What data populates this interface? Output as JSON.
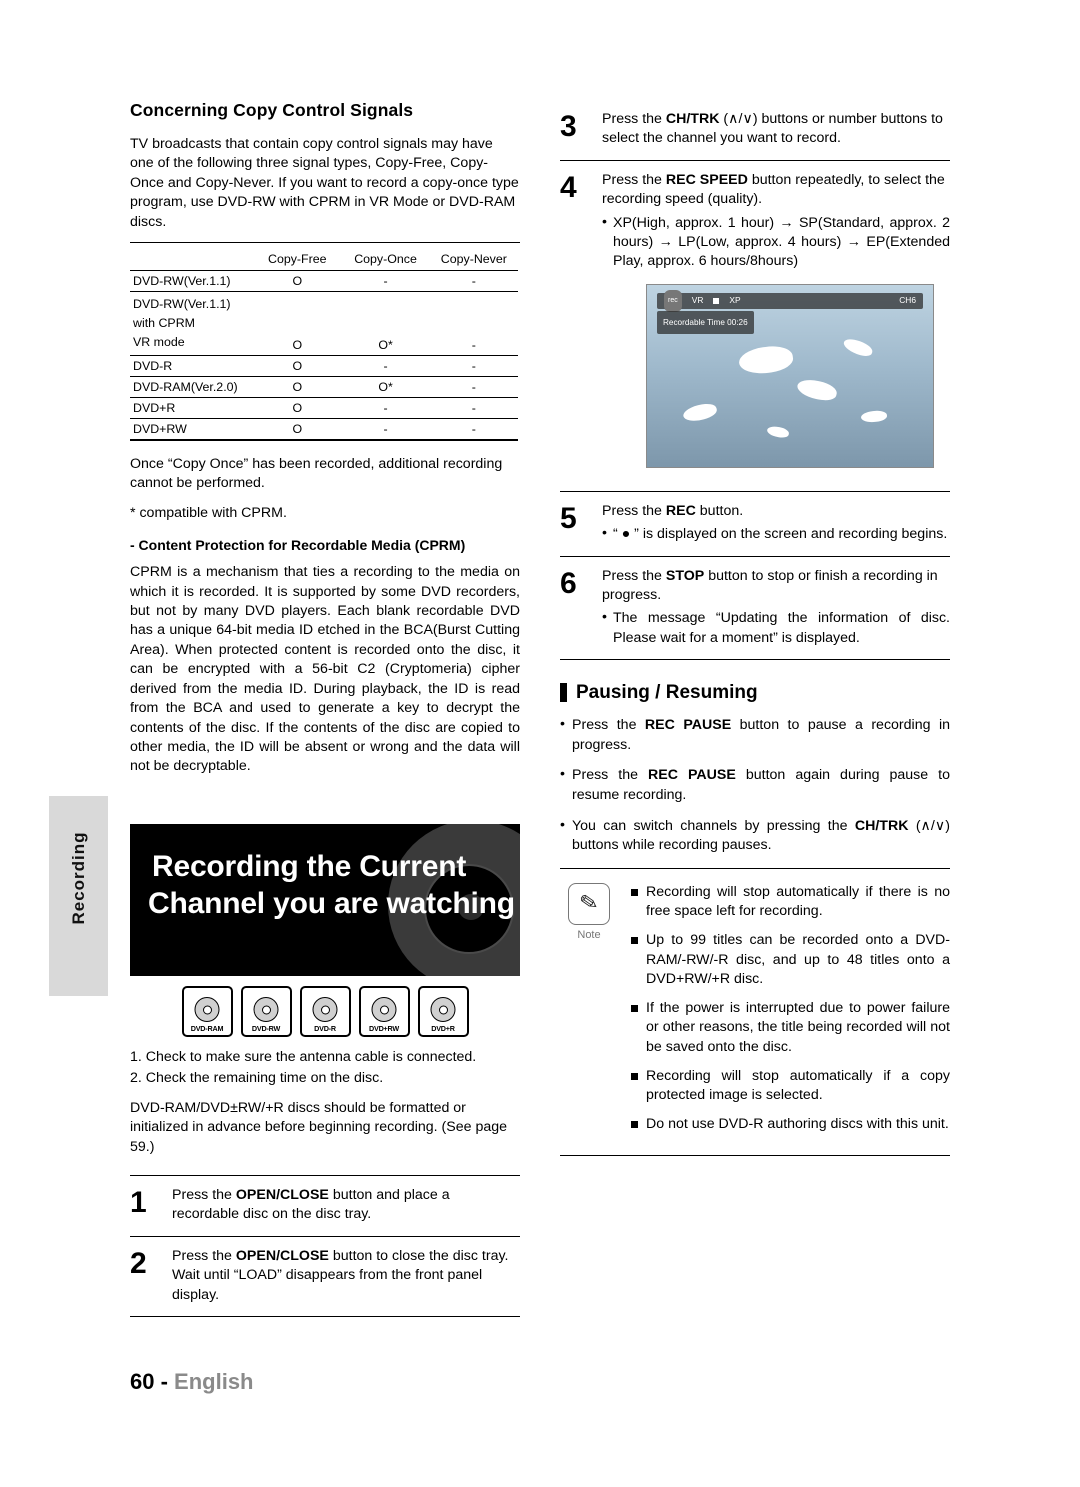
{
  "side_tab": {
    "label": "Recording"
  },
  "left": {
    "section_title": "Concerning Copy Control Signals",
    "intro": "TV broadcasts that contain copy control signals may have one of the following three signal types, Copy-Free, Copy-Once and Copy-Never. If you want to record a copy-once type program, use DVD-RW with CPRM in VR Mode or DVD-RAM discs.",
    "table": {
      "headers": [
        "",
        "Copy-Free",
        "Copy-Once",
        "Copy-Never"
      ],
      "rows": [
        {
          "label": "DVD-RW(Ver.1.1)",
          "cells": [
            "O",
            "-",
            "-"
          ]
        },
        {
          "label": "DVD-RW(Ver.1.1)\nwith CPRM\nVR mode",
          "cells": [
            "O",
            "O*",
            "-"
          ]
        },
        {
          "label": "DVD-R",
          "cells": [
            "O",
            "-",
            "-"
          ]
        },
        {
          "label": "DVD-RAM(Ver.2.0)",
          "cells": [
            "O",
            "O*",
            "-"
          ]
        },
        {
          "label": "DVD+R",
          "cells": [
            "O",
            "-",
            "-"
          ]
        },
        {
          "label": "DVD+RW",
          "cells": [
            "O",
            "-",
            "-"
          ]
        }
      ]
    },
    "after_table": "Once “Copy Once” has been recorded, additional recording cannot be performed.",
    "footnote": "* compatible with CPRM.",
    "cprm_head": "- Content Protection for Recordable Media (CPRM)",
    "cprm_body": "CPRM is a mechanism that ties a recording to the media on which it is recorded. It is supported by some DVD recorders, but not by many DVD players. Each blank recordable DVD has a unique 64-bit media ID etched in the BCA(Burst Cutting Area). When protected content is recorded onto the disc, it can be encrypted with a 56-bit C2 (Cryptomeria) cipher derived from the media ID. During playback, the ID is read from the BCA and used to generate a key to decrypt the contents of the disc.  If the contents of the disc are copied to other media, the ID will be absent or wrong and the data will not be decryptable.",
    "title_block": {
      "line1": "Recording the Current",
      "line2": "Channel you are watching"
    },
    "disc_logos": [
      "DVD-RAM",
      "DVD-RW",
      "DVD-R",
      "DVD+RW",
      "DVD+R"
    ],
    "checklist": [
      "1. Check to make sure the antenna cable is connected.",
      "2. Check the remaining time on the disc."
    ],
    "format_note": "DVD-RAM/DVD±RW/+R discs should be formatted or initialized in advance before beginning recording. (See page 59.)",
    "steps": [
      {
        "num": "1",
        "html": "Press the <b>OPEN/CLOSE</b> button and place a recordable disc on the disc tray."
      },
      {
        "num": "2",
        "html": "Press the <b>OPEN/CLOSE</b> button to close the disc tray.<br>Wait until “LOAD” disappears from the front panel display."
      }
    ]
  },
  "right": {
    "steps": [
      {
        "num": "3",
        "html": "Press the <b>CH/TRK</b> (∧/∨) buttons or number buttons to select the channel you want to record."
      },
      {
        "num": "4",
        "html": "Press the <b>REC SPEED</b> button repeatedly, to select the recording speed (quality)."
      },
      {
        "num": "5",
        "html": "Press the <b>REC</b> button."
      },
      {
        "num": "6",
        "html": "Press the <b>STOP</b> button to stop or finish a recording in progress."
      }
    ],
    "step4_bullets": [
      "XP(High, approx. 1 hour) → SP(Standard, approx. 2 hours) → LP(Low, approx. 4 hours) → EP(Extended Play, approx. 6 hours/8hours)"
    ],
    "step5_bullets": [
      "“ ● ” is displayed on the screen and recording begins."
    ],
    "step6_bullets": [
      "The message “Updating the information of disc. Please wait for a moment” is displayed."
    ],
    "tv": {
      "mode": "VR",
      "speed": "XP",
      "channel": "CH6",
      "rec_badge": "rec",
      "time_label": "Recordable Time 00:26"
    },
    "pausing_title": "Pausing / Resuming",
    "pausing_bullets": [
      "Press the <b>REC PAUSE</b> button to pause a recording in progress.",
      "Press the <b>REC PAUSE</b> button again during pause to resume recording.",
      "You can switch channels by pressing the <b>CH/TRK</b> (∧/∨) buttons while recording pauses."
    ],
    "note": {
      "label": "Note",
      "items": [
        "Recording will stop automatically if there is no free space left for recording.",
        "Up to 99 titles can be recorded onto a DVD-RAM/-RW/-R disc, and up to 48 titles onto a DVD+RW/+R disc.",
        "If the power is interrupted due to power failure or other reasons, the title being recorded will not be saved onto the disc.",
        "Recording will stop automatically if a copy protected image is selected.",
        "Do not use DVD-R authoring discs with this unit."
      ]
    }
  },
  "footer": {
    "page": "60 -",
    "lang": "English"
  }
}
